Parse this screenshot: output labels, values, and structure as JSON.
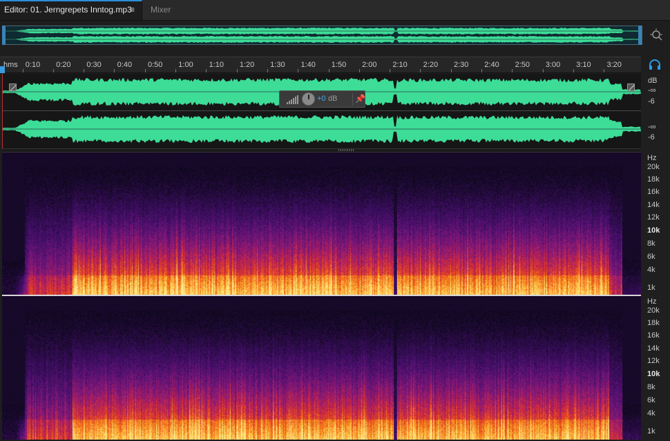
{
  "tabs": {
    "editor_label": "Editor: 01. Jerngrepets Inntog.mp3",
    "editor_menu": "≡",
    "mixer_label": "Mixer"
  },
  "icons": {
    "zoom": "zoom-navigator-icon",
    "monitor": "headphones-monitor-icon",
    "pin": "pin-icon",
    "knob": "volume-knob-icon"
  },
  "colors": {
    "waveform": "#3ddc97",
    "accent": "#2b8fd9",
    "playhead": "#bb3333"
  },
  "ruler": {
    "units": "hms",
    "ticks": [
      "0:10",
      "0:20",
      "0:30",
      "0:40",
      "0:50",
      "1:00",
      "1:10",
      "1:20",
      "1:30",
      "1:40",
      "1:50",
      "2:00",
      "2:10",
      "2:20",
      "2:30",
      "2:40",
      "2:50",
      "3:00",
      "3:10",
      "3:20"
    ]
  },
  "hud": {
    "value": "+0",
    "unit": "dB"
  },
  "db_scale": {
    "channel1": [
      "dB",
      "-∞",
      "-6"
    ],
    "channel2": [
      "-∞",
      "-6"
    ]
  },
  "hz_scale": {
    "channel1": [
      "Hz",
      "20k",
      "18k",
      "16k",
      "14k",
      "12k",
      "10k",
      "8k",
      "6k",
      "4k",
      "1k"
    ],
    "channel2": [
      "Hz",
      "20k",
      "18k",
      "16k",
      "14k",
      "12k",
      "10k",
      "8k",
      "6k",
      "4k",
      "1k"
    ]
  }
}
